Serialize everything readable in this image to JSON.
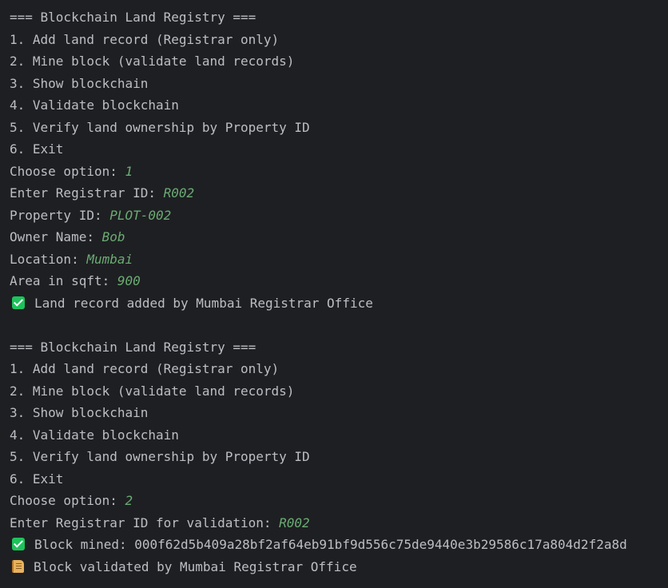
{
  "colors": {
    "background": "#1e1f22",
    "text": "#bcbec4",
    "user_input": "#6aab73",
    "success": "#1ec25c"
  },
  "session1": {
    "header": "=== Blockchain Land Registry ===",
    "menu": [
      "1. Add land record (Registrar only)",
      "2. Mine block (validate land records)",
      "3. Show blockchain",
      "4. Validate blockchain",
      "5. Verify land ownership by Property ID",
      "6. Exit"
    ],
    "prompts": [
      {
        "label": "Choose option: ",
        "value": "1"
      },
      {
        "label": "Enter Registrar ID: ",
        "value": "R002"
      },
      {
        "label": "Property ID: ",
        "value": "PLOT-002"
      },
      {
        "label": "Owner Name: ",
        "value": "Bob"
      },
      {
        "label": "Location: ",
        "value": "Mumbai"
      },
      {
        "label": "Area in sqft: ",
        "value": "900"
      }
    ],
    "result": {
      "icon": "check-icon",
      "text": "Land record added by Mumbai Registrar Office"
    }
  },
  "session2": {
    "header": "=== Blockchain Land Registry ===",
    "menu": [
      "1. Add land record (Registrar only)",
      "2. Mine block (validate land records)",
      "3. Show blockchain",
      "4. Validate blockchain",
      "5. Verify land ownership by Property ID",
      "6. Exit"
    ],
    "prompts": [
      {
        "label": "Choose option: ",
        "value": "2"
      },
      {
        "label": "Enter Registrar ID for validation: ",
        "value": "R002"
      }
    ],
    "results": [
      {
        "icon": "check-icon",
        "text": "Block mined: 000f62d5b409a28bf2af64eb91bf9d556c75de9440e3b29586c17a804d2f2a8d"
      },
      {
        "icon": "scroll-icon",
        "text": "Block validated by Mumbai Registrar Office"
      }
    ]
  }
}
